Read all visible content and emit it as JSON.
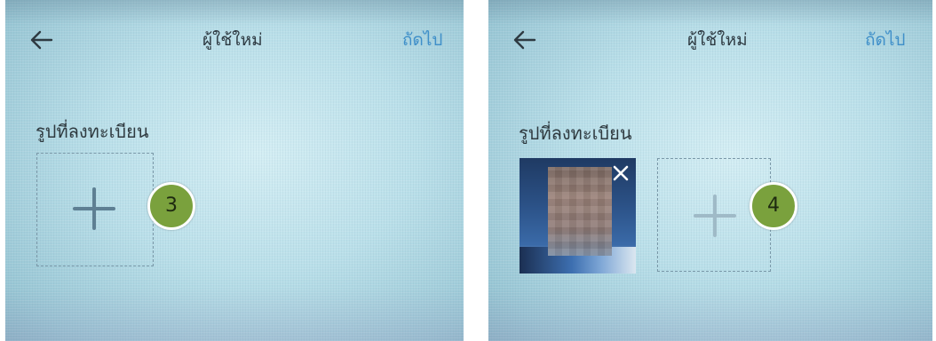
{
  "screens": [
    {
      "header": {
        "title": "ผู้ใช้ใหม่",
        "next_label": "ถัดไป",
        "back_icon": "arrow-left-icon"
      },
      "section_label": "รูปที่ลงทะเบียน",
      "add_photo_icon": "plus-icon",
      "step_badge": "3"
    },
    {
      "header": {
        "title": "ผู้ใช้ใหม่",
        "next_label": "ถัดไป",
        "back_icon": "arrow-left-icon"
      },
      "section_label": "รูปที่ลงทะเบียน",
      "photo": {
        "blurred": true,
        "remove_icon": "close-icon"
      },
      "add_photo_icon": "plus-icon",
      "step_badge": "4"
    }
  ],
  "colors": {
    "accent_link": "#3f8fc9",
    "badge_fill": "#7aa13d",
    "screen_bg": "#c3e4ec"
  }
}
